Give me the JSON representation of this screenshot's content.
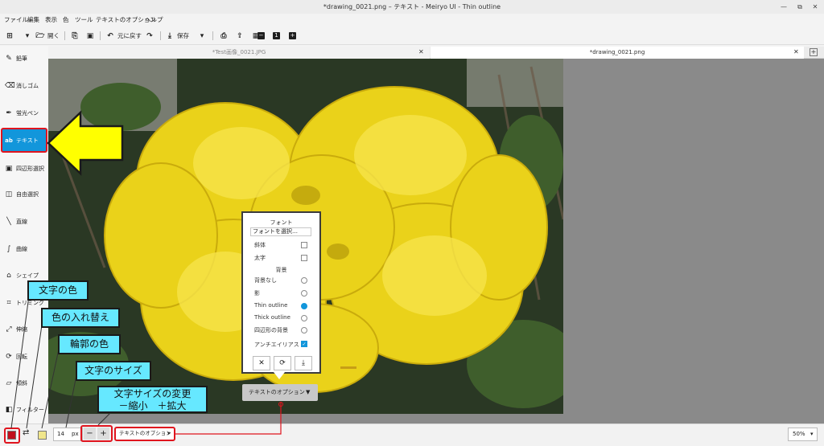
{
  "window": {
    "title": "*drawing_0021.png – テキスト - Meiryo UI - Thin outline"
  },
  "menu": [
    "ファイル",
    "編集",
    "表示",
    "色",
    "ツール",
    "テキストのオプション",
    "ヘルプ"
  ],
  "toolbar": {
    "open": "開く",
    "undo": "元に戻す",
    "save": "保存"
  },
  "tools": [
    "鉛筆",
    "消しゴム",
    "蛍光ペン",
    "テキスト",
    "四辺形選択",
    "自由選択",
    "直線",
    "曲線",
    "シェイプ",
    "トリミング",
    "伸縮",
    "回転",
    "傾斜",
    "フィルター"
  ],
  "tabs": [
    {
      "label": "*Test画像_0021.JPG"
    },
    {
      "label": "*drawing_0021.png"
    }
  ],
  "popup": {
    "font_header": "フォント",
    "font_select": "フォントを選択…",
    "italic": "斜体",
    "bold": "太字",
    "bg_header": "背景",
    "bg_options": [
      "背景なし",
      "影",
      "Thin outline",
      "Thick outline",
      "四辺形の背景"
    ],
    "antialias": "アンチエイリアス",
    "menu_button": "テキストのオプション"
  },
  "bottombar": {
    "font_size": "14",
    "unit": "px",
    "minus": "−",
    "plus": "+",
    "options": "テキストのオプション",
    "zoom": "50%"
  },
  "colors": {
    "text_color": "#c0101c",
    "outline_color": "#f0e68c",
    "accent": "#1296db",
    "callout": "#66e8ff",
    "highlight": "#e0141e"
  },
  "callouts": {
    "text_color": "文字の色",
    "swap": "色の入れ替え",
    "outline_color": "輪郭の色",
    "size": "文字のサイズ",
    "size_change_line1": "文字サイズの変更",
    "size_change_line2": "－縮小　＋拡大"
  }
}
